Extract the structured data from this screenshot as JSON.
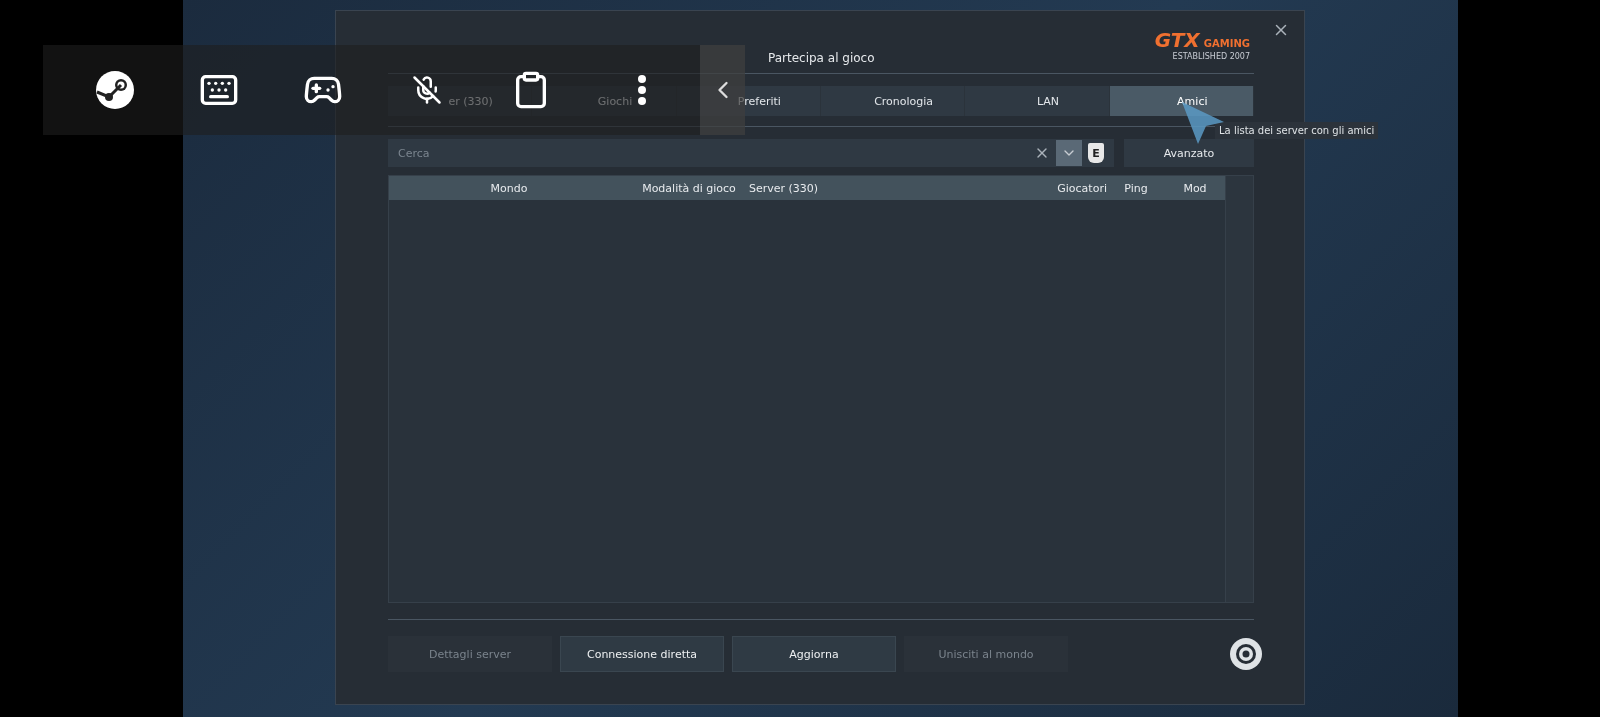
{
  "dialog": {
    "title": "Partecipa al gioco",
    "logo": {
      "text": "GTX",
      "subtext": "GAMING",
      "tagline": "ESTABLISHED 2007"
    }
  },
  "tabs": [
    {
      "label": "er (330)",
      "selected": false
    },
    {
      "label": "Giochi",
      "selected": false
    },
    {
      "label": "Preferiti",
      "selected": false
    },
    {
      "label": "Cronologia",
      "selected": false
    },
    {
      "label": "LAN",
      "selected": false
    },
    {
      "label": "Amici",
      "selected": true
    }
  ],
  "tooltip": "La lista dei server con gli amici",
  "search": {
    "placeholder": "Cerca",
    "filter_on": true,
    "badge": "E",
    "advanced_button": "Avanzato"
  },
  "table": {
    "columns": [
      "Mondo",
      "Modalità di gioco",
      "Server (330)",
      "Giocatori",
      "Ping",
      "Mod"
    ]
  },
  "buttons": [
    {
      "label": "Dettagli server",
      "disabled": true
    },
    {
      "label": "Connessione diretta",
      "disabled": false
    },
    {
      "label": "Aggiorna",
      "disabled": false
    },
    {
      "label": "Unisciti al mondo",
      "disabled": true
    }
  ],
  "overlay_toolbar": {
    "microphone_muted": true
  }
}
